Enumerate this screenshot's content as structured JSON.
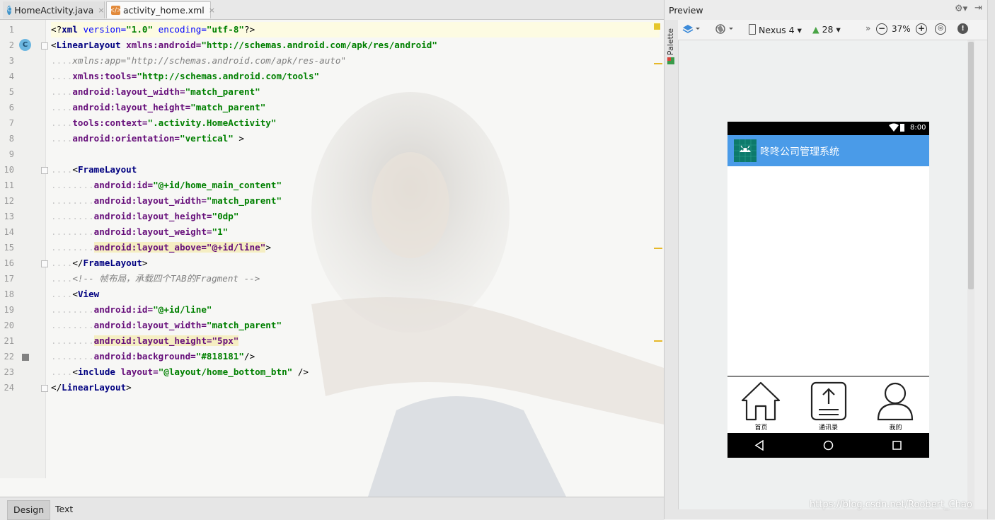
{
  "editor": {
    "tabs": [
      {
        "label": "HomeActivity.java",
        "icon": "java-class-icon"
      },
      {
        "label": "activity_home.xml",
        "icon": "layout-xml-icon"
      }
    ],
    "lines": [
      {
        "n": "1",
        "parts": [
          [
            "punct",
            "<?"
          ],
          [
            "tag",
            "xml"
          ],
          [
            "attr",
            " version="
          ],
          [
            "val",
            "\"1.0\""
          ],
          [
            "attr",
            " encoding="
          ],
          [
            "val",
            "\"utf-8\""
          ],
          [
            "punct",
            "?>"
          ]
        ]
      },
      {
        "n": "2",
        "parts": [
          [
            "punct",
            "<"
          ],
          [
            "tag",
            "LinearLayout"
          ],
          [
            "attr-ns",
            " xmlns:android="
          ],
          [
            "val",
            "\"http://schemas.android.com/apk/res/android\""
          ]
        ]
      },
      {
        "n": "3",
        "parts": [
          [
            "dots",
            "...."
          ],
          [
            "comment",
            "xmlns:app=\"http://schemas.android.com/apk/res-auto\""
          ]
        ]
      },
      {
        "n": "4",
        "parts": [
          [
            "dots",
            "...."
          ],
          [
            "attr-ns",
            "xmlns:tools="
          ],
          [
            "val",
            "\"http://schemas.android.com/tools\""
          ]
        ]
      },
      {
        "n": "5",
        "parts": [
          [
            "dots",
            "...."
          ],
          [
            "attr-ns",
            "android:layout_width="
          ],
          [
            "val",
            "\"match_parent\""
          ]
        ]
      },
      {
        "n": "6",
        "parts": [
          [
            "dots",
            "...."
          ],
          [
            "attr-ns",
            "android:layout_height="
          ],
          [
            "val",
            "\"match_parent\""
          ]
        ]
      },
      {
        "n": "7",
        "parts": [
          [
            "dots",
            "...."
          ],
          [
            "attr-ns",
            "tools:context="
          ],
          [
            "val",
            "\".activity.HomeActivity\""
          ]
        ]
      },
      {
        "n": "8",
        "parts": [
          [
            "dots",
            "...."
          ],
          [
            "attr-ns",
            "android:orientation="
          ],
          [
            "val",
            "\"vertical\""
          ],
          [
            "punct",
            " >"
          ]
        ]
      },
      {
        "n": "9",
        "parts": []
      },
      {
        "n": "10",
        "parts": [
          [
            "dots",
            "...."
          ],
          [
            "punct",
            "<"
          ],
          [
            "tag",
            "FrameLayout"
          ]
        ]
      },
      {
        "n": "11",
        "parts": [
          [
            "dots",
            "........"
          ],
          [
            "attr-ns",
            "android:id="
          ],
          [
            "val",
            "\"@+id/home_main_content\""
          ]
        ]
      },
      {
        "n": "12",
        "parts": [
          [
            "dots",
            "........"
          ],
          [
            "attr-ns",
            "android:layout_width="
          ],
          [
            "val",
            "\"match_parent\""
          ]
        ]
      },
      {
        "n": "13",
        "parts": [
          [
            "dots",
            "........"
          ],
          [
            "attr-ns",
            "android:layout_height="
          ],
          [
            "val",
            "\"0dp\""
          ]
        ]
      },
      {
        "n": "14",
        "parts": [
          [
            "dots",
            "........"
          ],
          [
            "attr-ns",
            "android:layout_weight="
          ],
          [
            "val",
            "\"1\""
          ]
        ]
      },
      {
        "n": "15",
        "parts": [
          [
            "dots",
            "........"
          ],
          [
            "hl",
            "android:layout_above=\"@+id/line\""
          ],
          [
            "punct",
            ">"
          ]
        ]
      },
      {
        "n": "16",
        "parts": [
          [
            "dots",
            "...."
          ],
          [
            "punct",
            "</"
          ],
          [
            "tag",
            "FrameLayout"
          ],
          [
            "punct",
            ">"
          ]
        ]
      },
      {
        "n": "17",
        "parts": [
          [
            "dots",
            "...."
          ],
          [
            "comment",
            "<!-- 帧布局，承载四个TAB的Fragment -->"
          ]
        ]
      },
      {
        "n": "18",
        "parts": [
          [
            "dots",
            "...."
          ],
          [
            "punct",
            "<"
          ],
          [
            "tag",
            "View"
          ]
        ]
      },
      {
        "n": "19",
        "parts": [
          [
            "dots",
            "........"
          ],
          [
            "attr-ns",
            "android:id="
          ],
          [
            "val",
            "\"@+id/line\""
          ]
        ]
      },
      {
        "n": "20",
        "parts": [
          [
            "dots",
            "........"
          ],
          [
            "attr-ns",
            "android:layout_width="
          ],
          [
            "val",
            "\"match_parent\""
          ]
        ]
      },
      {
        "n": "21",
        "parts": [
          [
            "dots",
            "........"
          ],
          [
            "hl",
            "android:layout_height=\"5px\""
          ]
        ]
      },
      {
        "n": "22",
        "parts": [
          [
            "dots",
            "........"
          ],
          [
            "attr-ns",
            "android:background="
          ],
          [
            "val",
            "\"#818181\""
          ],
          [
            "punct",
            "/>"
          ]
        ]
      },
      {
        "n": "23",
        "parts": [
          [
            "dots",
            "...."
          ],
          [
            "punct",
            "<"
          ],
          [
            "tag",
            "include"
          ],
          [
            "attr-ns",
            " layout="
          ],
          [
            "val",
            "\"@layout/home_bottom_btn\""
          ],
          [
            "punct",
            " />"
          ]
        ]
      },
      {
        "n": "24",
        "parts": [
          [
            "punct",
            "</"
          ],
          [
            "tag",
            "LinearLayout"
          ],
          [
            "punct",
            ">"
          ]
        ]
      }
    ],
    "bottom_tabs": [
      "Design",
      "Text"
    ],
    "selected_bottom_tab": "Design"
  },
  "preview": {
    "title": "Preview",
    "palette_label": "Palette",
    "device": "Nexus 4",
    "api_level": "28",
    "zoom": "37%",
    "phone": {
      "time": "8:00",
      "app_title": "咚咚公司管理系统",
      "nav_items": [
        {
          "label": "首页",
          "icon": "home-icon"
        },
        {
          "label": "通讯录",
          "icon": "upload-icon"
        },
        {
          "label": "我的",
          "icon": "person-icon"
        }
      ]
    },
    "watermark": "https://blog.csdn.net/Roobert_Chao"
  },
  "colors": {
    "appbar": "#4a9be8",
    "divider": "#818181",
    "xml_tag": "#000080",
    "xml_attr": "#660e7a",
    "xml_value": "#008000"
  }
}
